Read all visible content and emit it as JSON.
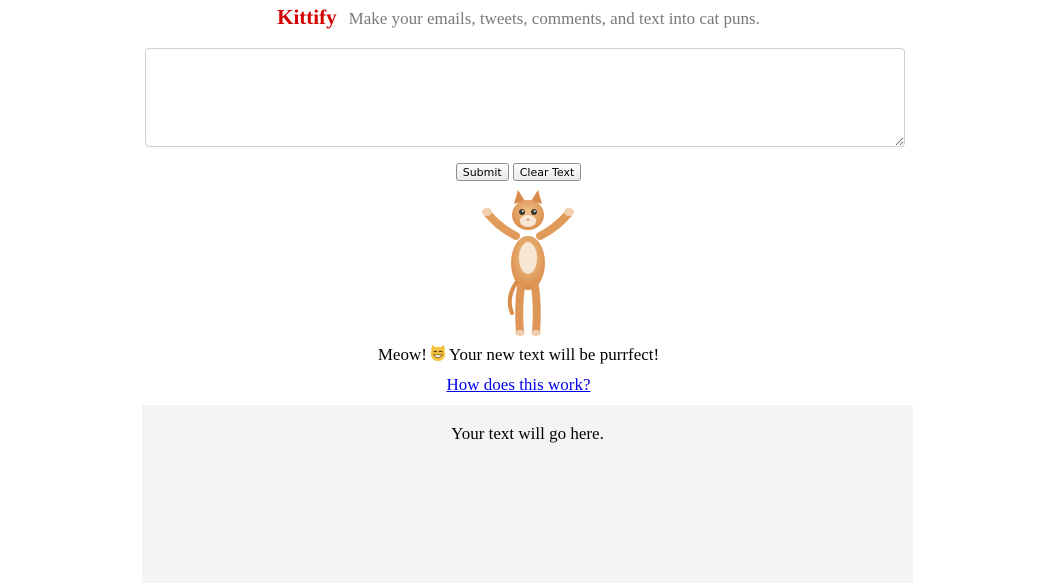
{
  "header": {
    "brand": "Kittify",
    "tagline": "Make your emails, tweets, comments, and text into cat puns."
  },
  "input": {
    "value": "",
    "placeholder": ""
  },
  "buttons": {
    "submit_label": "Submit",
    "clear_label": "Clear Text"
  },
  "illustration": {
    "icon": "dancing-kitten-image"
  },
  "message": {
    "before": "Meow!",
    "emoji_icon": "grinning-cat-emoji",
    "after": "Your new text will be purrfect!"
  },
  "help_link": {
    "label": "How does this work?"
  },
  "output": {
    "text": "Your text will go here."
  },
  "colors": {
    "brand": "#d40000",
    "tagline": "#7a7a7a",
    "link": "#0000ee",
    "output_bg": "#f4f4f4"
  }
}
